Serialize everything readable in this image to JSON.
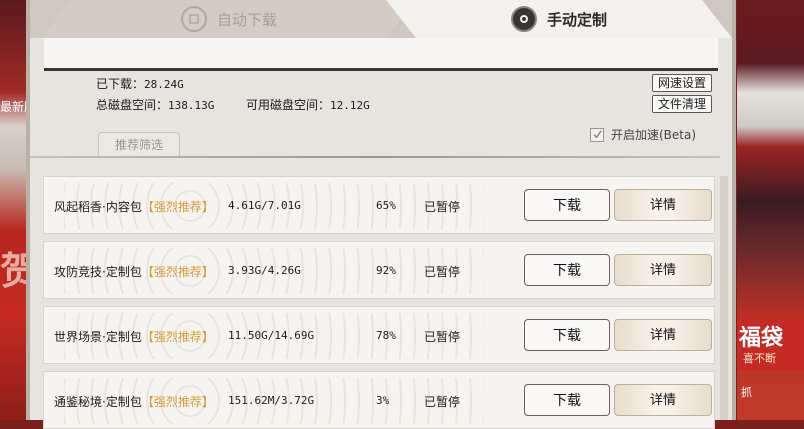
{
  "backdrop": {
    "left_text": "最新版",
    "right_banner_big": "福袋",
    "right_banner_small": "喜不断",
    "right_bottom_text": "抓"
  },
  "tabs": [
    {
      "label": "自动下载",
      "active": false,
      "icon": "download-badge-icon"
    },
    {
      "label": "手动定制",
      "active": true,
      "icon": "custom-badge-icon"
    }
  ],
  "stats": {
    "downloaded_label": "已下载：",
    "downloaded_value": "28.24G",
    "total_label": "总磁盘空间：",
    "total_value": "138.13G",
    "free_label": "可用磁盘空间：",
    "free_value": "12.12G"
  },
  "buttons": {
    "network_settings": "网速设置",
    "file_cleanup": "文件清理"
  },
  "filter_tab": "推荐筛选",
  "acceleration": {
    "label": "开启加速(Beta)",
    "checked": true
  },
  "packages": [
    {
      "name": "风起稻香·内容包",
      "tag": "【强烈推荐】",
      "size": "4.61G/7.01G",
      "percent": "65%",
      "progress": 65,
      "status": "已暂停",
      "download": "下载",
      "details": "详情"
    },
    {
      "name": "攻防竞技·定制包",
      "tag": "【强烈推荐】",
      "size": "3.93G/4.26G",
      "percent": "92%",
      "progress": 92,
      "status": "已暂停",
      "download": "下载",
      "details": "详情"
    },
    {
      "name": "世界场景·定制包",
      "tag": "【强烈推荐】",
      "size": "11.50G/14.69G",
      "percent": "78%",
      "progress": 78,
      "status": "已暂停",
      "download": "下载",
      "details": "详情"
    },
    {
      "name": "通鉴秘境·定制包",
      "tag": "【强烈推荐】",
      "size": "151.62M/3.72G",
      "percent": "3%",
      "progress": 3,
      "status": "已暂停",
      "download": "下载",
      "details": "详情"
    }
  ],
  "colors": {
    "accent_tag": "#d69c3b",
    "panel_bg": "#e7e3de"
  }
}
